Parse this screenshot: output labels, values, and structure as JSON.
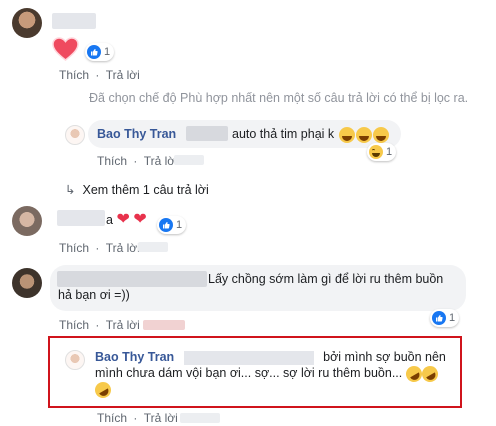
{
  "comments": [
    {
      "likes": "1",
      "actions": {
        "like": "Thích",
        "dot": "·",
        "reply": "Trả lời"
      }
    },
    {
      "filtered_notice": "Đã chọn chế độ Phù hợp nhất nên một số câu trả lời có thể bị lọc ra."
    },
    {
      "author": "Bao Thy Tran",
      "text": "auto thả tim phại k",
      "reaction_count": "1",
      "actions": {
        "like": "Thích",
        "dot": "·",
        "reply": "Trả lời"
      }
    },
    {
      "see_more": "Xem thêm 1 câu trả lời"
    },
    {
      "text_suffix": "a",
      "likes": "1",
      "actions": {
        "like": "Thích",
        "dot": "·",
        "reply": "Trả lời"
      }
    },
    {
      "text": "Lấy chồng sớm làm gì để lời ru thêm buồn hả bạn ơi =))",
      "likes": "1",
      "actions": {
        "like": "Thích",
        "dot": "·",
        "reply": "Trả lời"
      }
    },
    {
      "author": "Bao Thy Tran",
      "text": "bởi mình sợ buồn nên mình chưa dám vội bạn ơi... sợ... sợ lời ru thêm buồn...",
      "actions": {
        "like": "Thích",
        "dot": "·",
        "reply": "Trả lời"
      }
    }
  ],
  "colors": {
    "link": "#385898",
    "meta": "#606770",
    "bubble": "#f2f3f5",
    "highlight": "#d0141c",
    "like_blue": "#1877f2"
  },
  "icons": {
    "like": "thumbs-up-icon",
    "heart": "heart-icon",
    "haha": "laughing-emoji-icon",
    "rofl": "rofl-emoji-icon",
    "reply_arrow": "reply-arrow-icon"
  }
}
